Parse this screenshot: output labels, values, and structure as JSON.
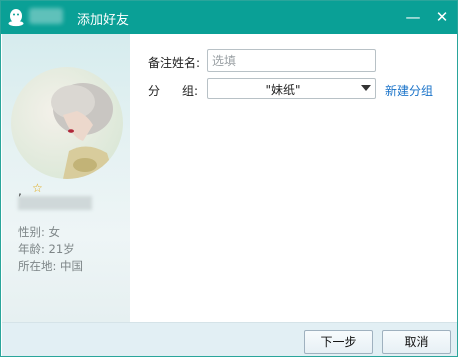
{
  "window": {
    "title": "添加好友",
    "minimize_glyph": "—",
    "close_glyph": "✕"
  },
  "profile": {
    "nickname_char": ",",
    "star_glyph": "☆",
    "gender": "性别: 女",
    "age": "年龄: 21岁",
    "location": "所在地: 中国"
  },
  "form": {
    "remark_label": "备注姓名:",
    "remark_value": "",
    "remark_placeholder": "选填",
    "group_label_a": "分",
    "group_label_b": "组:",
    "group_selected": "\"妹纸\"",
    "new_group_link": "新建分组"
  },
  "footer": {
    "next_label": "下一步",
    "cancel_label": "取消"
  },
  "colors": {
    "titlebar": "#0aa096",
    "link": "#1a73c9",
    "star": "#e0a812"
  },
  "icons": [
    "qq-penguin-icon",
    "minimize-icon",
    "close-icon",
    "star-icon",
    "dropdown-arrow-icon"
  ]
}
